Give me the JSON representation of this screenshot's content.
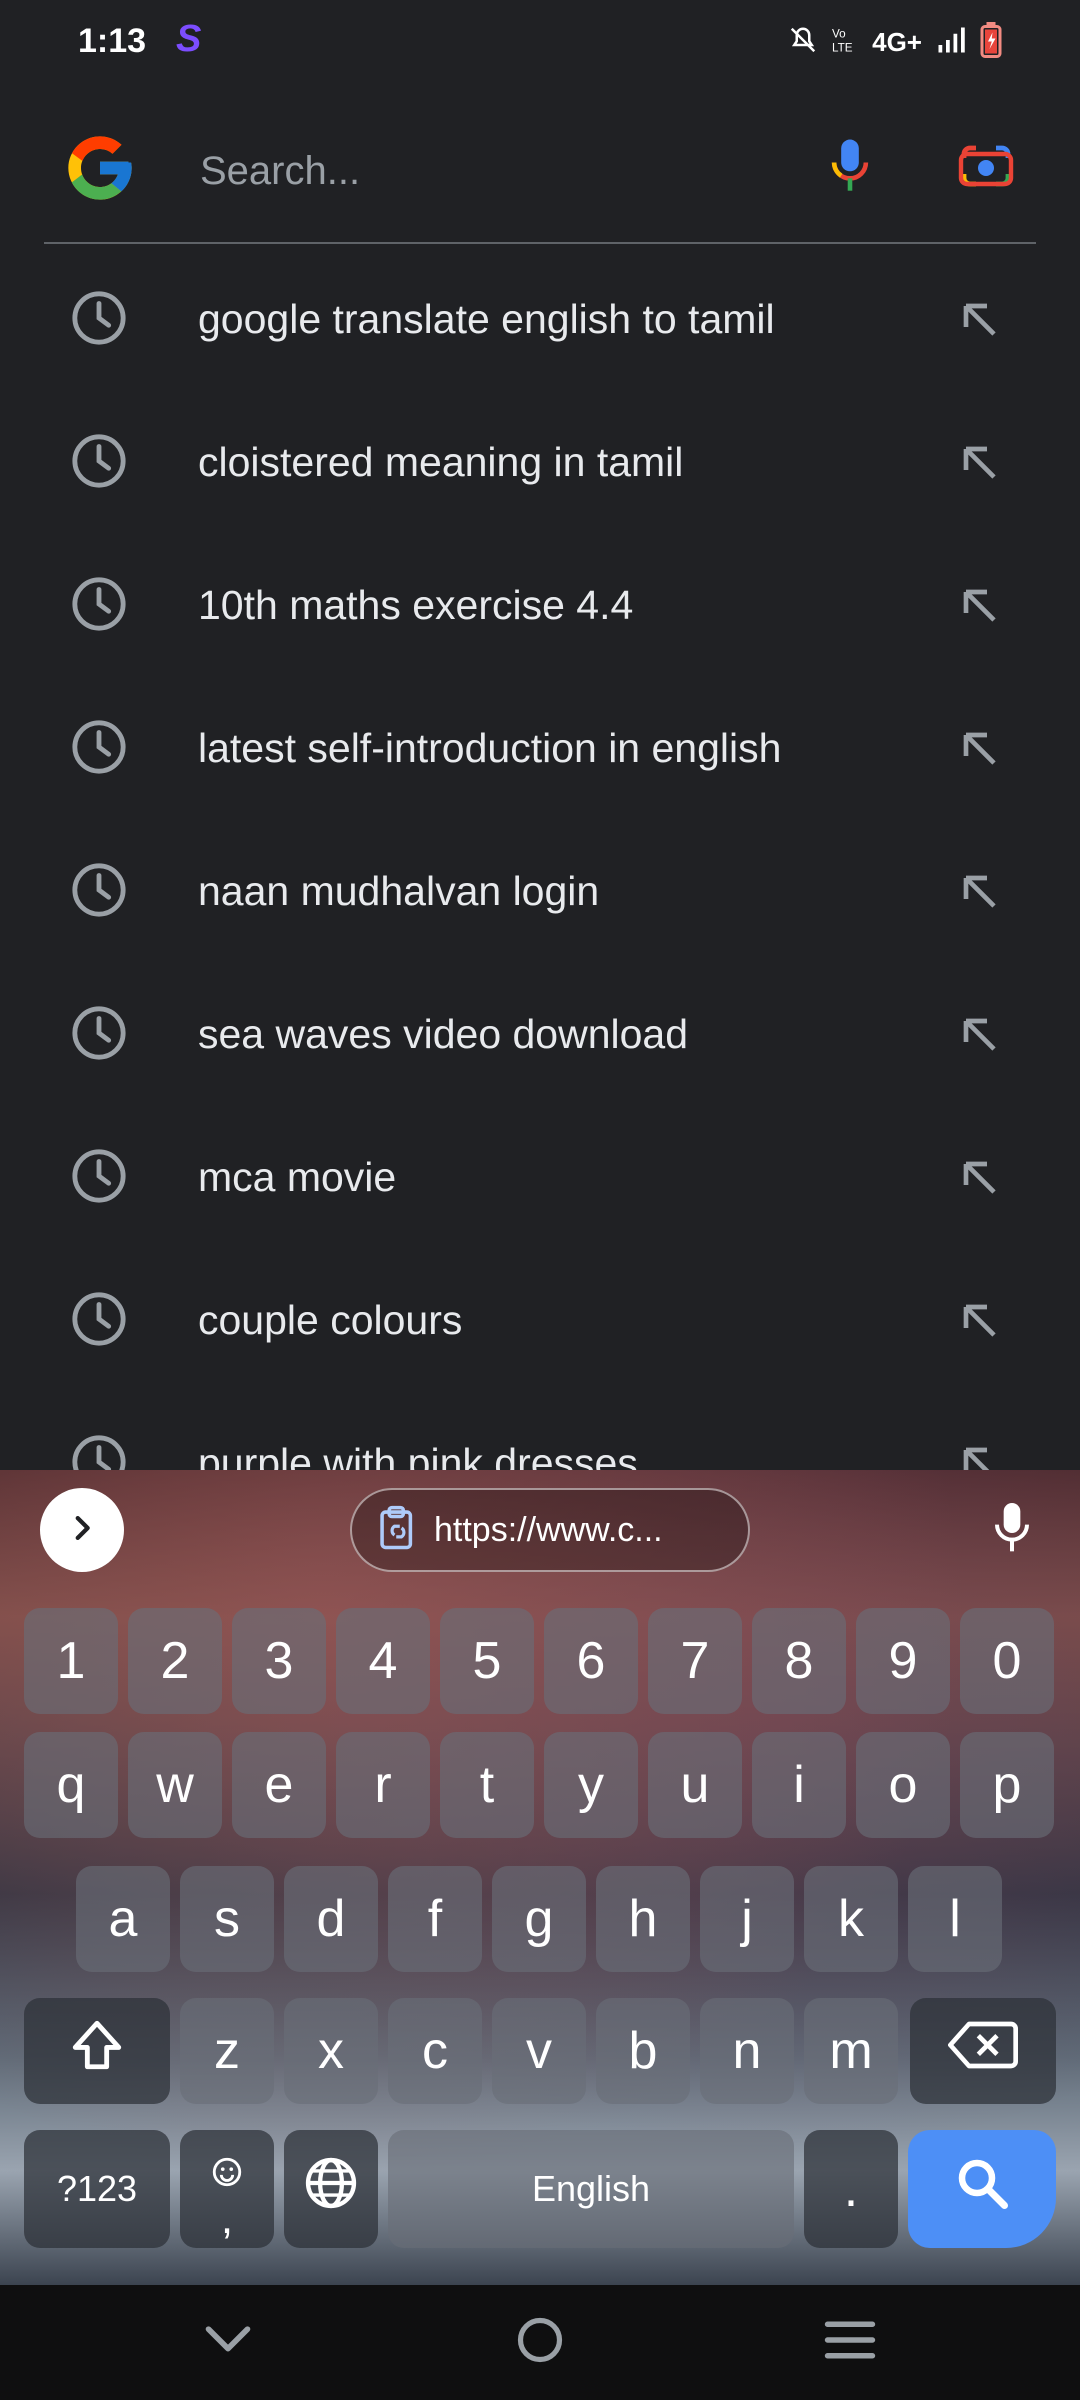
{
  "status_bar": {
    "time": "1:13",
    "app_badge": "S",
    "network": "4G+"
  },
  "search": {
    "placeholder": "Search..."
  },
  "suggestions": [
    "google translate english to tamil",
    "cloistered meaning in tamil",
    "10th maths exercise 4.4",
    "latest self-introduction in english",
    "naan mudhalvan login",
    "sea waves video download",
    "mca movie",
    "couple colours",
    "purple with pink dresses"
  ],
  "keyboard": {
    "clipboard_text": "https://www.c...",
    "number_row": [
      "1",
      "2",
      "3",
      "4",
      "5",
      "6",
      "7",
      "8",
      "9",
      "0"
    ],
    "row1": [
      "q",
      "w",
      "e",
      "r",
      "t",
      "y",
      "u",
      "i",
      "o",
      "p"
    ],
    "row2": [
      "a",
      "s",
      "d",
      "f",
      "g",
      "h",
      "j",
      "k",
      "l"
    ],
    "row3": [
      "z",
      "x",
      "c",
      "v",
      "b",
      "n",
      "m"
    ],
    "symbols_label": "?123",
    "comma_label": ",",
    "space_label": "English",
    "period_label": "."
  },
  "colors": {
    "background": "#202124",
    "accent": "#4d8ff6",
    "app_badge": "#7c4dff"
  },
  "icons": [
    "google-logo-icon",
    "mic-icon",
    "lens-icon",
    "history-clock-icon",
    "fill-arrow-icon",
    "chevron-right-icon",
    "clipboard-icon",
    "shift-icon",
    "backspace-icon",
    "emoji-icon",
    "globe-icon",
    "search-icon"
  ]
}
